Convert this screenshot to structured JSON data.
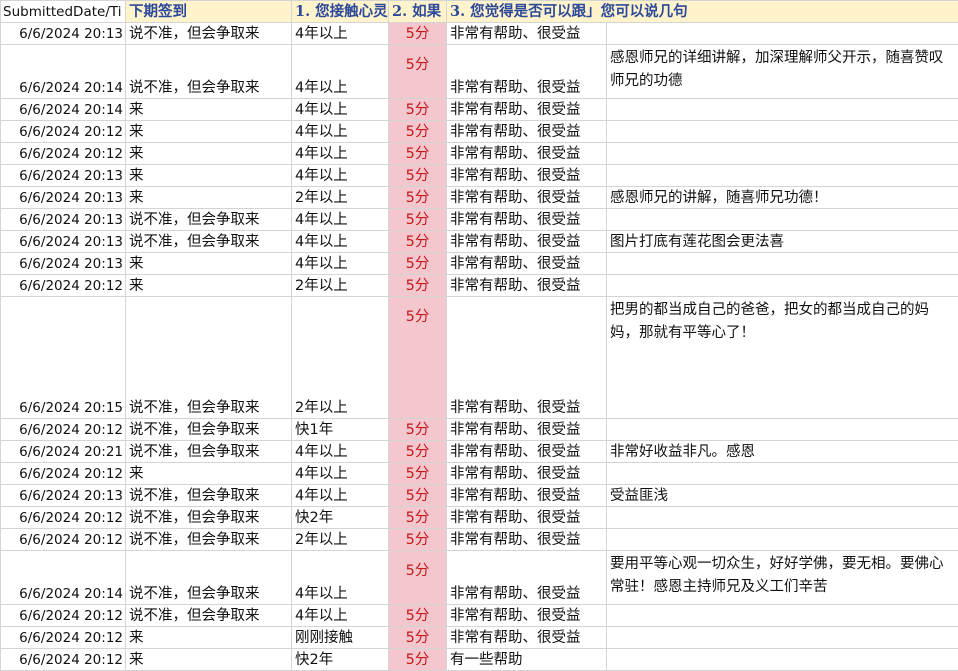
{
  "headers": [
    "SubmittedDate/Ti",
    "下期签到",
    "1. 您接触心灵",
    "2. 如果",
    "3. 您觉得是否可以跟」您可以说几句"
  ],
  "rows": [
    {
      "date": "6/6/2024 20:13",
      "attend": "说不准，但会争取来",
      "years": "4年以上",
      "score": "5分",
      "help": "非常有帮助、很受益",
      "comment": "",
      "h": 1
    },
    {
      "date": "6/6/2024 20:14",
      "attend": "说不准，但会争取来",
      "years": "4年以上",
      "score": "5分",
      "help": "非常有帮助、很受益",
      "comment": "感恩师兄的详细讲解，加深理解师父开示，随喜赞叹师兄的功德",
      "h": 2
    },
    {
      "date": "6/6/2024 20:14",
      "attend": "来",
      "years": "4年以上",
      "score": "5分",
      "help": "非常有帮助、很受益",
      "comment": "",
      "h": 1
    },
    {
      "date": "6/6/2024 20:12",
      "attend": "来",
      "years": "4年以上",
      "score": "5分",
      "help": "非常有帮助、很受益",
      "comment": "",
      "h": 1
    },
    {
      "date": "6/6/2024 20:12",
      "attend": "来",
      "years": "4年以上",
      "score": "5分",
      "help": "非常有帮助、很受益",
      "comment": "",
      "h": 1
    },
    {
      "date": "6/6/2024 20:13",
      "attend": "来",
      "years": "4年以上",
      "score": "5分",
      "help": "非常有帮助、很受益",
      "comment": "",
      "h": 1
    },
    {
      "date": "6/6/2024 20:13",
      "attend": "来",
      "years": "2年以上",
      "score": "5分",
      "help": "非常有帮助、很受益",
      "comment": "感恩师兄的讲解，随喜师兄功德！",
      "h": 1
    },
    {
      "date": "6/6/2024 20:13",
      "attend": "说不准，但会争取来",
      "years": "4年以上",
      "score": "5分",
      "help": "非常有帮助、很受益",
      "comment": "",
      "h": 1
    },
    {
      "date": "6/6/2024 20:13",
      "attend": "说不准，但会争取来",
      "years": "4年以上",
      "score": "5分",
      "help": "非常有帮助、很受益",
      "comment": "图片打底有莲花图会更法喜",
      "h": 1
    },
    {
      "date": "6/6/2024 20:13",
      "attend": "来",
      "years": "4年以上",
      "score": "5分",
      "help": "非常有帮助、很受益",
      "comment": "",
      "h": 1
    },
    {
      "date": "6/6/2024 20:12",
      "attend": "来",
      "years": "2年以上",
      "score": "5分",
      "help": "非常有帮助、很受益",
      "comment": "",
      "h": 1
    },
    {
      "date": "6/6/2024 20:15",
      "attend": "说不准，但会争取来",
      "years": "2年以上",
      "score": "5分",
      "help": "非常有帮助、很受益",
      "comment": "把男的都当成自己的爸爸，把女的都当成自己的妈妈，那就有平等心了！",
      "h": 5
    },
    {
      "date": "6/6/2024 20:12",
      "attend": "说不准，但会争取来",
      "years": "快1年",
      "score": "5分",
      "help": "非常有帮助、很受益",
      "comment": "",
      "h": 1
    },
    {
      "date": "6/6/2024 20:21",
      "attend": "说不准，但会争取来",
      "years": "4年以上",
      "score": "5分",
      "help": "非常有帮助、很受益",
      "comment": "非常好收益非凡。感恩",
      "h": 1
    },
    {
      "date": "6/6/2024 20:12",
      "attend": "来",
      "years": "4年以上",
      "score": "5分",
      "help": "非常有帮助、很受益",
      "comment": "",
      "h": 1
    },
    {
      "date": "6/6/2024 20:13",
      "attend": "说不准，但会争取来",
      "years": "4年以上",
      "score": "5分",
      "help": "非常有帮助、很受益",
      "comment": "受益匪浅",
      "h": 1
    },
    {
      "date": "6/6/2024 20:12",
      "attend": "说不准，但会争取来",
      "years": "快2年",
      "score": "5分",
      "help": "非常有帮助、很受益",
      "comment": "",
      "h": 1
    },
    {
      "date": "6/6/2024 20:12",
      "attend": "说不准，但会争取来",
      "years": "2年以上",
      "score": "5分",
      "help": "非常有帮助、很受益",
      "comment": "",
      "h": 1
    },
    {
      "date": "6/6/2024 20:14",
      "attend": "说不准，但会争取来",
      "years": "4年以上",
      "score": "5分",
      "help": "非常有帮助、很受益",
      "comment": "要用平等心观一切众生，好好学佛，要无相。要佛心常驻！感恩主持师兄及义工们辛苦",
      "h": 2
    },
    {
      "date": "6/6/2024 20:12",
      "attend": "说不准，但会争取来",
      "years": "4年以上",
      "score": "5分",
      "help": "非常有帮助、很受益",
      "comment": "",
      "h": 1
    },
    {
      "date": "6/6/2024 20:12",
      "attend": "来",
      "years": "刚刚接触",
      "score": "5分",
      "help": "非常有帮助、很受益",
      "comment": "",
      "h": 1
    },
    {
      "date": "6/6/2024 20:12",
      "attend": "来",
      "years": "快2年",
      "score": "5分",
      "help": "有一些帮助",
      "comment": "",
      "h": 1
    }
  ]
}
